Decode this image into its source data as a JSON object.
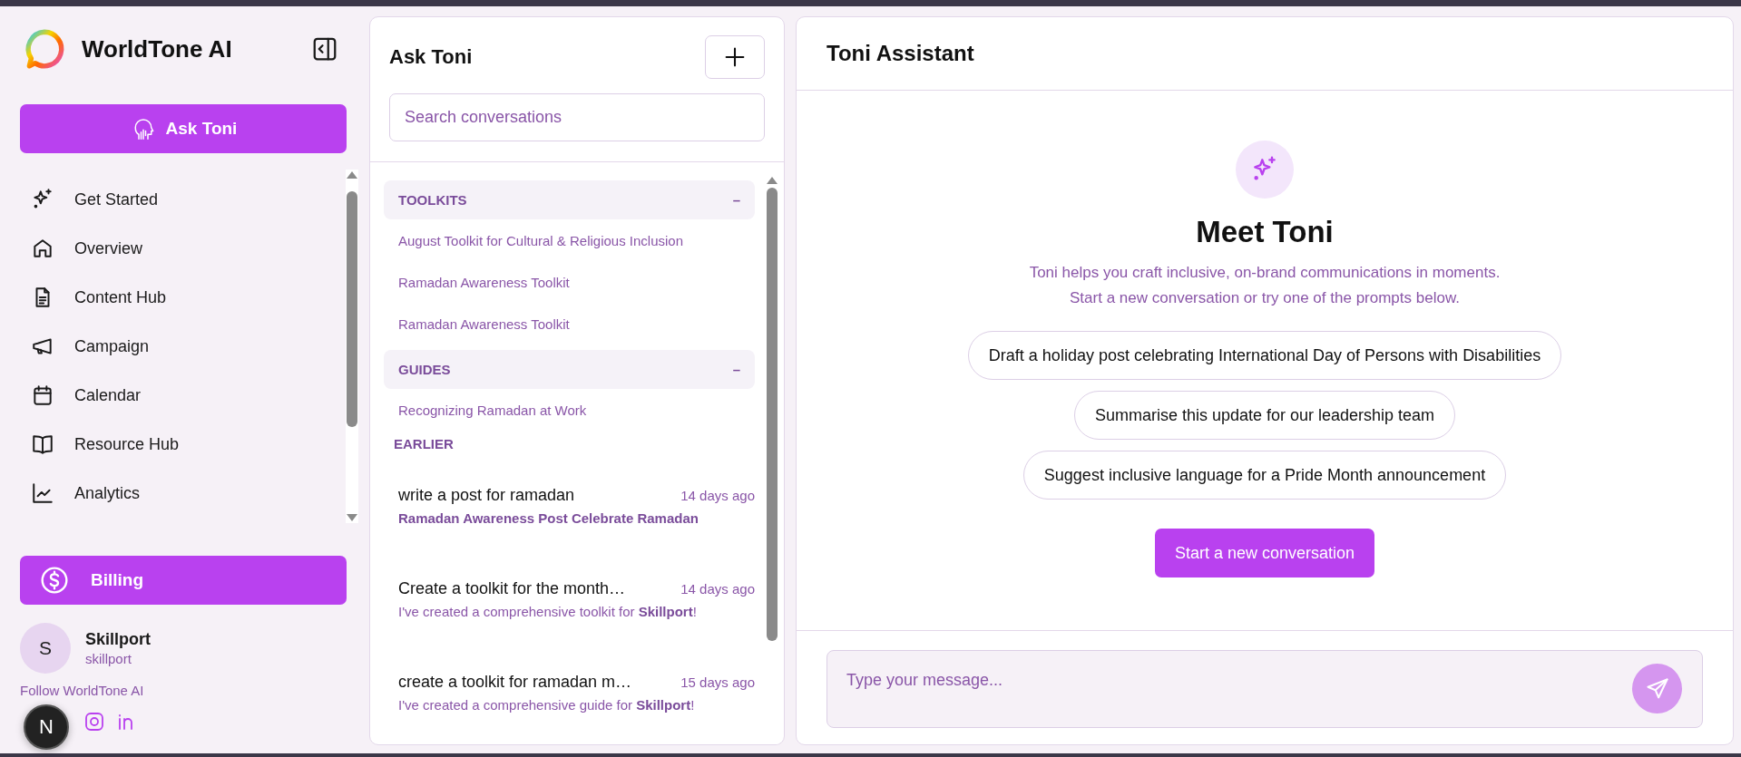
{
  "sidebar": {
    "brand": "WorldTone AI",
    "ask_button": "Ask Toni",
    "nav": [
      {
        "label": "Get Started"
      },
      {
        "label": "Overview"
      },
      {
        "label": "Content Hub"
      },
      {
        "label": "Campaign"
      },
      {
        "label": "Calendar"
      },
      {
        "label": "Resource Hub"
      },
      {
        "label": "Analytics"
      }
    ],
    "billing": "Billing",
    "user": {
      "initial": "S",
      "name": "Skillport",
      "handle": "skillport"
    },
    "follow": "Follow WorldTone AI",
    "floating_badge": "N"
  },
  "conversations": {
    "title": "Ask Toni",
    "search": {
      "placeholder": "Search conversations"
    },
    "groups": [
      {
        "label": "TOOLKITS",
        "toggle": "–",
        "items": [
          "August Toolkit for Cultural & Religious Inclusion",
          "Ramadan Awareness Toolkit",
          "Ramadan Awareness Toolkit"
        ]
      },
      {
        "label": "GUIDES",
        "toggle": "–",
        "items": [
          "Recognizing Ramadan at Work"
        ]
      }
    ],
    "earlier": {
      "label": "EARLIER",
      "items": [
        {
          "title": "write a post for ramadan",
          "time": "14 days ago",
          "preview": "**Ramadan Awareness Post Celebrate Ramadan**"
        },
        {
          "title": "Create a toolkit for the month…",
          "time": "14 days ago",
          "preview": "I've created a comprehensive toolkit for **Skillport**!"
        },
        {
          "title": "create a toolkit for ramadan m…",
          "time": "15 days ago",
          "preview": "I've created a comprehensive guide for **Skillport**!"
        }
      ]
    }
  },
  "assistant": {
    "title": "Toni Assistant",
    "heading": "Meet Toni",
    "intro": [
      "Toni helps you craft inclusive, on-brand communications in moments.",
      "Start a new conversation or try one of the prompts below."
    ],
    "prompts": [
      "Draft a holiday post celebrating International Day of Persons with Disabilities",
      "Summarise this update for our leadership team",
      "Suggest inclusive language for a Pride Month announcement"
    ],
    "start_button": "Start a new conversation",
    "composer": {
      "placeholder": "Type your message..."
    }
  }
}
